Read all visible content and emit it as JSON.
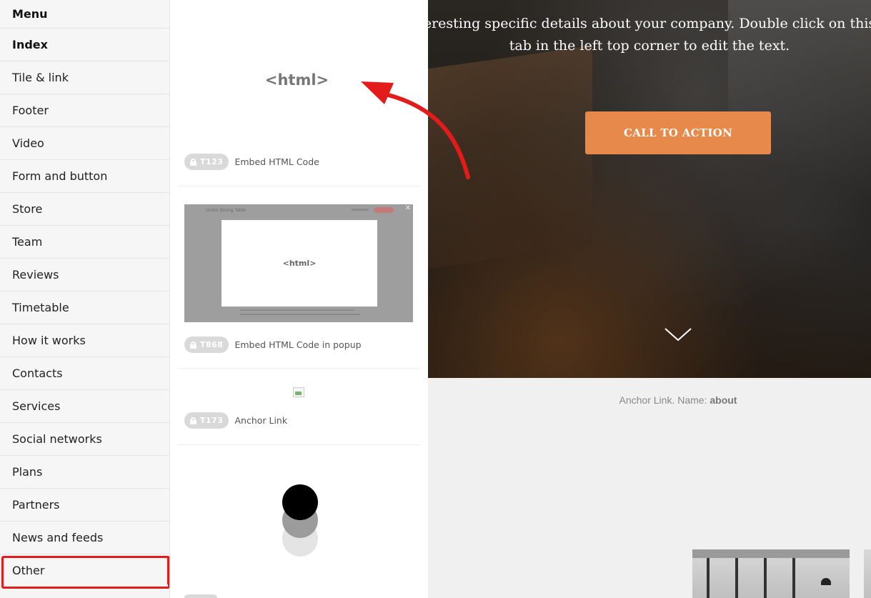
{
  "sidebar": {
    "items": [
      {
        "label": "Menu"
      },
      {
        "label": "Index"
      },
      {
        "label": "Tile & link"
      },
      {
        "label": "Footer"
      },
      {
        "label": "Video"
      },
      {
        "label": "Form and button"
      },
      {
        "label": "Store"
      },
      {
        "label": "Team"
      },
      {
        "label": "Reviews"
      },
      {
        "label": "Timetable"
      },
      {
        "label": "How it works"
      },
      {
        "label": "Contacts"
      },
      {
        "label": "Services"
      },
      {
        "label": "Social networks"
      },
      {
        "label": "Plans"
      },
      {
        "label": "Partners"
      },
      {
        "label": "News and feeds"
      },
      {
        "label": "Other"
      }
    ]
  },
  "blocks": [
    {
      "preview_text": "<html>",
      "code": "T123",
      "label": "Embed HTML Code"
    },
    {
      "preview_text": "<html>",
      "code": "T868",
      "label": "Embed HTML Code in popup",
      "popup_title": "Union Dining Table"
    },
    {
      "code": "T173",
      "label": "Anchor Link"
    }
  ],
  "hero": {
    "text": "eresting specific details about your company. Double click on this tab in the left top corner to edit the text.",
    "cta": "CALL TO ACTION"
  },
  "anchor": {
    "prefix": "Anchor Link. Name:",
    "name": "about"
  },
  "colors": {
    "cta": "#e8894c",
    "highlight": "#e31b1b",
    "arrow": "#e31b1b"
  }
}
